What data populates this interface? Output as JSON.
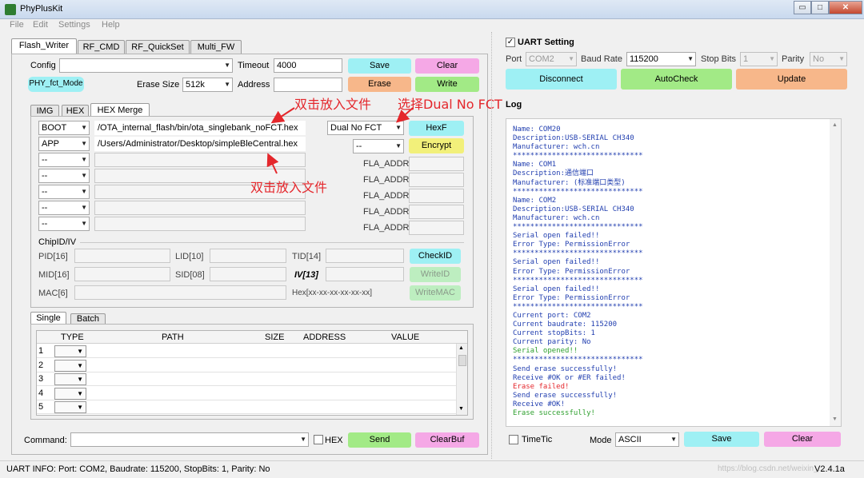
{
  "window": {
    "title": "PhyPlusKit",
    "min": "▭",
    "max": "□",
    "close": "✕"
  },
  "menu": [
    "File",
    "Edit",
    "Settings",
    "Help"
  ],
  "tabs": [
    "Flash_Writer",
    "RF_CMD",
    "RF_QuickSet",
    "Multi_FW"
  ],
  "config": {
    "label": "Config",
    "value": "",
    "timeout_label": "Timeout",
    "timeout_value": "4000",
    "mode_badge": "PHY_fct_Mode",
    "erase_size_label": "Erase Size",
    "erase_size_value": "512k",
    "address_label": "Address",
    "address_value": ""
  },
  "buttons": {
    "save": "Save",
    "clear": "Clear",
    "erase": "Erase",
    "write": "Write",
    "hexf": "HexF",
    "encrypt": "Encrypt",
    "checkid": "CheckID",
    "writeid": "WriteID",
    "writemac": "WriteMAC",
    "send": "Send",
    "clearbuf": "ClearBuf"
  },
  "subtabs": [
    "IMG",
    "HEX",
    "HEX Merge"
  ],
  "hex_rows": [
    {
      "type": "BOOT",
      "path": "/OTA_internal_flash/bin/ota_singlebank_noFCT.hex"
    },
    {
      "type": "APP",
      "path": "/Users/Administrator/Desktop/simpleBleCentral.hex"
    },
    {
      "type": "--",
      "path": ""
    },
    {
      "type": "--",
      "path": ""
    },
    {
      "type": "--",
      "path": ""
    },
    {
      "type": "--",
      "path": ""
    },
    {
      "type": "--",
      "path": ""
    }
  ],
  "merge_combo": "Dual No FCT",
  "merge_combo2": "--",
  "fla_addr_label": "FLA_ADDR",
  "annotations": {
    "a1": "双击放入文件",
    "a2": "选择Dual No FCT",
    "a3": "双击放入文件"
  },
  "chipid": {
    "legend": "ChipID/IV",
    "pid": "PID[16]",
    "lid": "LID[10]",
    "tid": "TID[14]",
    "mid": "MID[16]",
    "sid": "SID[08]",
    "iv": "IV[13]",
    "mac": "MAC[6]",
    "hex": "Hex[xx-xx-xx-xx-xx-xx]"
  },
  "bottomtabs": [
    "Single",
    "Batch"
  ],
  "table": {
    "headers": [
      "TYPE",
      "PATH",
      "SIZE",
      "ADDRESS",
      "VALUE"
    ],
    "rows": [
      "1",
      "2",
      "3",
      "4",
      "5"
    ]
  },
  "command": {
    "label": "Command:",
    "value": "",
    "hex_label": "HEX"
  },
  "uart": {
    "title": "UART Setting",
    "port_label": "Port",
    "port_value": "COM2",
    "baud_label": "Baud Rate",
    "baud_value": "115200",
    "stopbits_label": "Stop Bits",
    "stopbits_value": "1",
    "parity_label": "Parity",
    "parity_value": "No",
    "disconnect": "Disconnect",
    "autocheck": "AutoCheck",
    "update": "Update"
  },
  "log": {
    "title": "Log",
    "lines": [
      {
        "t": "Name: COM20",
        "c": "#2340b0"
      },
      {
        "t": "Description:USB-SERIAL CH340",
        "c": "#2340b0"
      },
      {
        "t": "Manufacturer: wch.cn",
        "c": "#2340b0"
      },
      {
        "t": "******************************",
        "c": "#2340b0"
      },
      {
        "t": "Name: COM1",
        "c": "#2340b0"
      },
      {
        "t": "Description:通信端口",
        "c": "#2340b0"
      },
      {
        "t": "Manufacturer: (标准端口类型)",
        "c": "#2340b0"
      },
      {
        "t": "******************************",
        "c": "#2340b0"
      },
      {
        "t": "Name: COM2",
        "c": "#2340b0"
      },
      {
        "t": "Description:USB-SERIAL CH340",
        "c": "#2340b0"
      },
      {
        "t": "Manufacturer: wch.cn",
        "c": "#2340b0"
      },
      {
        "t": "******************************",
        "c": "#2340b0"
      },
      {
        "t": "Serial open failed!!",
        "c": "#2340b0"
      },
      {
        "t": "Error Type: PermissionError",
        "c": "#2340b0"
      },
      {
        "t": "******************************",
        "c": "#2340b0"
      },
      {
        "t": "Serial open failed!!",
        "c": "#2340b0"
      },
      {
        "t": "Error Type: PermissionError",
        "c": "#2340b0"
      },
      {
        "t": "******************************",
        "c": "#2340b0"
      },
      {
        "t": "Serial open failed!!",
        "c": "#2340b0"
      },
      {
        "t": "Error Type: PermissionError",
        "c": "#2340b0"
      },
      {
        "t": "******************************",
        "c": "#2340b0"
      },
      {
        "t": "Current port: COM2",
        "c": "#2340b0"
      },
      {
        "t": "Current baudrate: 115200",
        "c": "#2340b0"
      },
      {
        "t": "Current stopBits: 1",
        "c": "#2340b0"
      },
      {
        "t": "Current parity: No",
        "c": "#2340b0"
      },
      {
        "t": "Serial opened!!",
        "c": "#2ea02e"
      },
      {
        "t": "******************************",
        "c": "#2340b0"
      },
      {
        "t": "Send erase successfully!",
        "c": "#2340b0"
      },
      {
        "t": "Receive #OK or #ER failed!",
        "c": "#2340b0"
      },
      {
        "t": "Erase failed!",
        "c": "#e4272c"
      },
      {
        "t": "Send erase successfully!",
        "c": "#2340b0"
      },
      {
        "t": "Receive #OK!",
        "c": "#2340b0"
      },
      {
        "t": "Erase successfully!",
        "c": "#2ea02e"
      }
    ]
  },
  "logfoot": {
    "timetic": "TimeTic",
    "mode_label": "Mode",
    "mode_value": "ASCII",
    "save": "Save",
    "clear": "Clear"
  },
  "status": {
    "text": "UART INFO: Port: COM2, Baudrate: 115200, StopBits: 1, Parity: No",
    "watermark": "https://blog.csdn.net/weixin_...",
    "version": "V2.4.1a"
  },
  "colors": {
    "cyan": "#9ef0f4",
    "pink": "#f5a8e6",
    "orange": "#f7b78a",
    "green": "#a2ea86",
    "yellow": "#f2f07a",
    "annotation": "#e4272c"
  }
}
